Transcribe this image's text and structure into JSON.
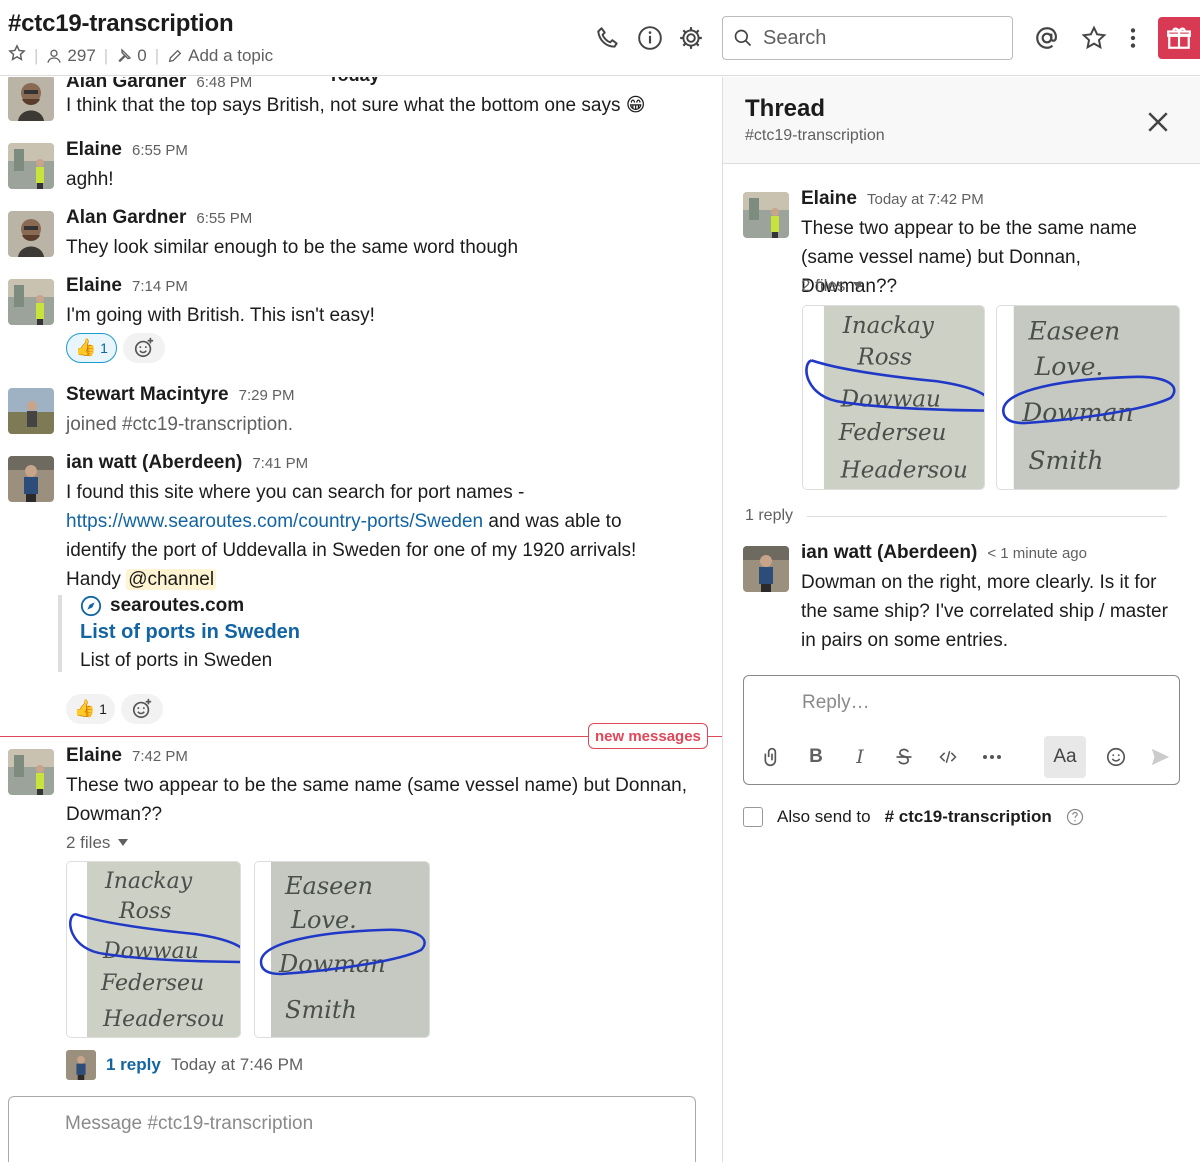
{
  "header": {
    "channel_name": "#ctc19-transcription",
    "members": "297",
    "pins": "0",
    "topic_placeholder": "Add a topic",
    "search_placeholder": "Search"
  },
  "day_divider": "Today",
  "messages": [
    {
      "author": "Alan Gardner",
      "time": "6:48 PM",
      "text": "I think that the top says British, not sure what the bottom one says 😁"
    },
    {
      "author": "Elaine",
      "time": "6:55 PM",
      "text": "aghh!"
    },
    {
      "author": "Alan Gardner",
      "time": "6:55 PM",
      "text": "They look similar enough to be the same word though"
    },
    {
      "author": "Elaine",
      "time": "7:14 PM",
      "text": "I'm going with British. This isn't easy!",
      "reaction_count": "1"
    },
    {
      "author": "Stewart Macintyre",
      "time": "7:29 PM",
      "text": "joined #ctc19-transcription."
    },
    {
      "author": "ian watt (Aberdeen)",
      "time": "7:41 PM",
      "text_1": "I found this site where you can search for port names -",
      "link": "https://www.searoutes.com/country-ports/Sweden",
      "text_2": " and was able to",
      "text_3": "identify the port of Uddevalla in Sweden for one of my 1920 arrivals!",
      "text_4": "Handy ",
      "mention": "@channel",
      "unfurl": {
        "site": "searoutes.com",
        "title": "List of ports in Sweden",
        "description": "List of ports in Sweden"
      },
      "reaction_count": "1"
    },
    {
      "author": "Elaine",
      "time": "7:42 PM",
      "text_1": "These two appear to be the same name (same vessel name) but Donnan,",
      "text_2": "Dowman??",
      "files_label": "2 files",
      "reply_label": "1 reply",
      "reply_time": "Today at 7:46 PM"
    }
  ],
  "new_messages_label": "new messages",
  "composer_placeholder": "Message #ctc19-transcription",
  "thread": {
    "title": "Thread",
    "channel": "#ctc19-transcription",
    "parent": {
      "author": "Elaine",
      "time": "Today at 7:42 PM",
      "line_1": "These two appear to be the same name",
      "line_2": "(same vessel name) but Donnan, Dowman??",
      "files_label": "2 files"
    },
    "reply_count": "1 reply",
    "reply": {
      "author": "ian watt (Aberdeen)",
      "time": "< 1 minute ago",
      "line_1": "Dowman on the right, more clearly. Is it for",
      "line_2": "the same ship? I've correlated ship / master",
      "line_3": "in pairs on some entries."
    },
    "composer_placeholder": "Reply…",
    "also_send_label": "Also send to",
    "also_send_channel": "# ctc19-transcription",
    "toolbar": {
      "bold": "B",
      "italic": "I",
      "aa": "Aa"
    }
  },
  "image_text": {
    "left_col": [
      "Inackay",
      "Ross",
      "Dowwau",
      "Federseu",
      "Headersou"
    ],
    "right_col": [
      "Easeen",
      "Love.",
      "Dowman",
      "Smith"
    ]
  },
  "colors": {
    "link": "#1264a3",
    "new_messages": "#e0485a",
    "gift": "#d93a53",
    "mention_bg": "#fff4d1"
  }
}
